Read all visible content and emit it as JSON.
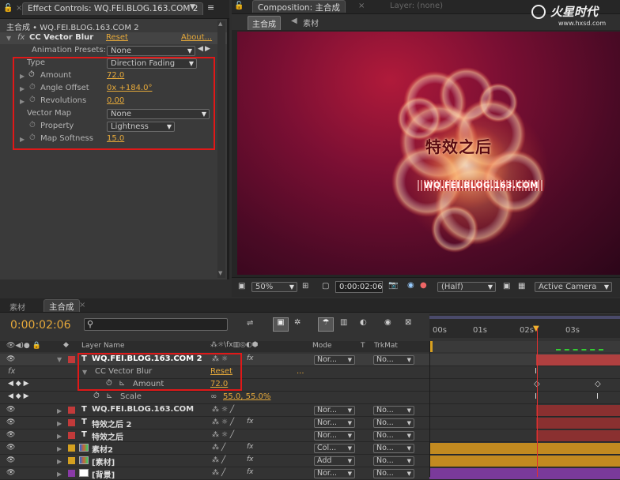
{
  "effect_controls": {
    "tab_label": "Effect Controls: WQ.FEI.BLOG.163.COM 2",
    "breadcrumb": "主合成 • WQ.FEI.BLOG.163.COM 2",
    "effect_name": "CC Vector Blur",
    "fx_label": "fx",
    "reset": "Reset",
    "about": "About...",
    "presets_label": "Animation Presets:",
    "presets_value": "None",
    "props": [
      {
        "name": "Type",
        "value": "Direction Fading",
        "kind": "dropdown"
      },
      {
        "name": "Amount",
        "value": "72.0",
        "kind": "value"
      },
      {
        "name": "Angle Offset",
        "value": "0x +184.0°",
        "kind": "value"
      },
      {
        "name": "Revolutions",
        "value": "0.00",
        "kind": "value"
      },
      {
        "name": "Vector Map",
        "value": "None",
        "kind": "dropdown"
      },
      {
        "name": "Property",
        "value": "Lightness",
        "kind": "dropdown"
      },
      {
        "name": "Map Softness",
        "value": "15.0",
        "kind": "value"
      }
    ]
  },
  "composition": {
    "tab_label": "Composition: 主合成",
    "layer_tab": "Layer: (none)",
    "subtabs": [
      "主合成",
      "素材"
    ],
    "title_text": "特效之后",
    "url_text": "WQ.FEI.BLOG.163.COM",
    "watermark": "www.hxsd.com",
    "logo_text": "火星时代",
    "zoom": "50%",
    "timecode": "0:00:02:06",
    "resolution": "(Half)",
    "camera": "Active Camera"
  },
  "timeline": {
    "tabs": [
      "素材",
      "主合成"
    ],
    "timecode": "0:00:02:06",
    "search_placeholder": "",
    "col_layer_name": "Layer Name",
    "col_mode": "Mode",
    "col_t": "T",
    "col_trkmat": "TrkMat",
    "ruler_ticks": [
      "00s",
      "01s",
      "02s",
      "03s"
    ],
    "sub_effect": "CC Vector Blur",
    "sub_reset": "Reset",
    "sub_dots": "...",
    "sub_amount_label": "Amount",
    "sub_amount_value": "72.0",
    "sub_scale_label": "Scale",
    "sub_scale_value": "55.0, 55.0%",
    "layers": [
      {
        "name": "WQ.FEI.BLOG.163.COM 2",
        "mode": "Nor...",
        "trk": "No...",
        "type": "T",
        "color": "#c23a3a"
      },
      {
        "name": "WQ.FEI.BLOG.163.COM",
        "mode": "Nor...",
        "trk": "No...",
        "type": "T",
        "color": "#c23a3a"
      },
      {
        "name": "特效之后 2",
        "mode": "Nor...",
        "trk": "No...",
        "type": "T",
        "color": "#c23a3a"
      },
      {
        "name": "特效之后",
        "mode": "Nor...",
        "trk": "No...",
        "type": "T",
        "color": "#c23a3a"
      },
      {
        "name": "素材2",
        "mode": "Col...",
        "trk": "No...",
        "type": "img",
        "color": "#d4a020"
      },
      {
        "name": "[素材]",
        "mode": "Add",
        "trk": "No...",
        "type": "img",
        "color": "#d4a020"
      },
      {
        "name": "[背景]",
        "mode": "Nor...",
        "trk": "No...",
        "type": "solid",
        "color": "#8a3aa8"
      }
    ]
  }
}
